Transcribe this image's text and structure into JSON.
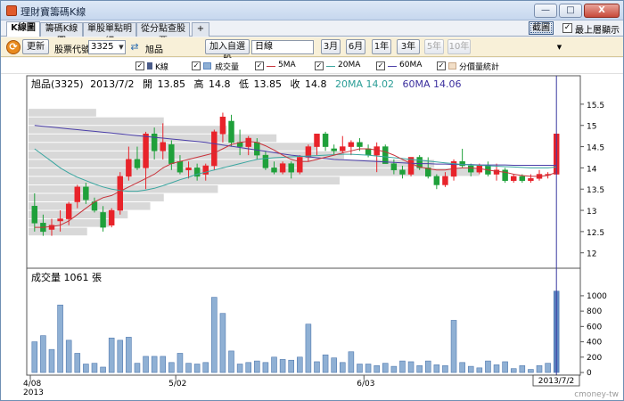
{
  "window": {
    "title": "理財寶籌碼K線",
    "minimize": "—",
    "maximize": "□",
    "close": "X"
  },
  "tabs": [
    "K線圖",
    "籌碼K線圖",
    "單股單點明細",
    "從分點查股票"
  ],
  "tab_add": "+",
  "screenshot_button": "截圖",
  "topmost": {
    "label": "最上層顯示",
    "checked": true
  },
  "toolbar": {
    "refresh": "更新",
    "code_label": "股票代號:",
    "code_value": "3325",
    "stock_name": "旭品",
    "add_fav": "加入自選股",
    "period": "日線",
    "ranges": [
      "3月",
      "6月",
      "1年",
      "3年",
      "5年",
      "10年"
    ],
    "ranges_disabled": [
      false,
      false,
      false,
      false,
      true,
      true
    ]
  },
  "legend": [
    {
      "label": "K線",
      "symbol": "candle"
    },
    {
      "label": "成交量",
      "symbol": "box"
    },
    {
      "label": "5MA",
      "symbol": "line-red"
    },
    {
      "label": "20MA",
      "symbol": "line-teal"
    },
    {
      "label": "60MA",
      "symbol": "line-navy"
    },
    {
      "label": "分價量統計",
      "symbol": "box-beige"
    }
  ],
  "colors": {
    "up": "#e8232a",
    "down": "#1fa03a",
    "ma5": "#c8323a",
    "ma20": "#3aa6a0",
    "ma60": "#4b3fa8",
    "volume": "#8fb0d4",
    "volume_highlight": "#5d88c2",
    "profile": "#d8d8d8",
    "cursor": "#3a3aa0"
  },
  "quote": {
    "name": "旭品(3325)",
    "date": "2013/7/2",
    "open_label": "開",
    "open": "13.85",
    "high_label": "高",
    "high": "14.8",
    "low_label": "低",
    "low": "13.85",
    "close_label": "收",
    "close": "14.8",
    "ma20": "20MA 14.02",
    "ma60": "60MA 14.06"
  },
  "volume_header": "成交量 1061 張",
  "watermark": "cmoney-tw",
  "chart_data": {
    "type": "candlestick",
    "price_axis": {
      "ticks": [
        "12",
        "12.5",
        "13",
        "13.5",
        "14",
        "14.5",
        "15",
        "15.5"
      ],
      "ylim": [
        11.7,
        15.75
      ]
    },
    "volume_axis": {
      "ticks": [
        "0",
        "200",
        "400",
        "600",
        "800",
        "1000"
      ],
      "ylim": [
        0,
        1150
      ]
    },
    "x_labels": [
      "4/08",
      "5/02",
      "6/03"
    ],
    "x_label_index": [
      0,
      17,
      39
    ],
    "year_label": "2013",
    "cursor_label": "2013/7/2",
    "candles": [
      [
        13.1,
        13.4,
        12.5,
        12.7,
        400
      ],
      [
        12.7,
        12.9,
        12.4,
        12.5,
        480
      ],
      [
        12.55,
        12.8,
        12.4,
        12.65,
        300
      ],
      [
        12.75,
        13.0,
        12.5,
        12.8,
        880
      ],
      [
        12.8,
        13.2,
        12.65,
        13.15,
        420
      ],
      [
        13.2,
        13.6,
        13.05,
        13.55,
        250
      ],
      [
        13.55,
        13.65,
        13.15,
        13.25,
        110
      ],
      [
        13.2,
        13.3,
        12.95,
        13.0,
        120
      ],
      [
        12.95,
        13.1,
        12.5,
        12.6,
        70
      ],
      [
        12.65,
        13.05,
        12.6,
        13.0,
        450
      ],
      [
        13.0,
        13.9,
        12.9,
        13.8,
        420
      ],
      [
        13.8,
        14.5,
        13.7,
        14.2,
        460
      ],
      [
        14.2,
        14.5,
        13.95,
        14.0,
        120
      ],
      [
        14.0,
        14.85,
        13.5,
        14.8,
        210
      ],
      [
        14.8,
        14.95,
        14.2,
        14.4,
        210
      ],
      [
        14.4,
        15.05,
        14.2,
        14.6,
        210
      ],
      [
        14.55,
        14.65,
        13.95,
        14.1,
        130
      ],
      [
        14.15,
        14.3,
        13.85,
        13.9,
        250
      ],
      [
        13.95,
        14.15,
        13.75,
        14.0,
        120
      ],
      [
        14.0,
        14.1,
        13.7,
        13.8,
        110
      ],
      [
        13.85,
        14.1,
        13.7,
        14.05,
        130
      ],
      [
        14.05,
        14.9,
        13.95,
        14.85,
        980
      ],
      [
        14.8,
        15.3,
        14.6,
        15.2,
        770
      ],
      [
        15.1,
        15.25,
        14.5,
        14.6,
        280
      ],
      [
        14.6,
        14.9,
        14.3,
        14.5,
        110
      ],
      [
        14.5,
        14.75,
        14.3,
        14.7,
        130
      ],
      [
        14.6,
        14.7,
        14.2,
        14.3,
        150
      ],
      [
        14.3,
        14.4,
        13.95,
        14.0,
        130
      ],
      [
        14.0,
        14.15,
        13.85,
        13.9,
        200
      ],
      [
        13.9,
        14.15,
        13.85,
        14.1,
        170
      ],
      [
        14.1,
        14.15,
        13.75,
        13.9,
        160
      ],
      [
        13.9,
        14.3,
        13.85,
        14.25,
        200
      ],
      [
        14.25,
        14.55,
        14.15,
        14.5,
        630
      ],
      [
        14.5,
        14.8,
        14.3,
        14.8,
        140
      ],
      [
        14.8,
        14.85,
        14.4,
        14.5,
        230
      ],
      [
        14.45,
        14.55,
        14.3,
        14.4,
        190
      ],
      [
        14.4,
        14.75,
        14.35,
        14.5,
        130
      ],
      [
        14.5,
        14.65,
        14.3,
        14.6,
        270
      ],
      [
        14.6,
        14.7,
        14.4,
        14.5,
        110
      ],
      [
        14.45,
        14.55,
        14.25,
        14.3,
        110
      ],
      [
        14.3,
        14.6,
        13.9,
        14.5,
        90
      ],
      [
        14.5,
        14.55,
        14.1,
        14.1,
        120
      ],
      [
        14.1,
        14.2,
        13.85,
        13.95,
        80
      ],
      [
        13.95,
        14.05,
        13.75,
        13.85,
        150
      ],
      [
        13.85,
        14.25,
        13.8,
        14.25,
        140
      ],
      [
        14.25,
        14.3,
        13.95,
        14.0,
        90
      ],
      [
        14.0,
        14.25,
        13.75,
        13.8,
        150
      ],
      [
        13.8,
        13.85,
        13.5,
        13.6,
        100
      ],
      [
        13.6,
        13.9,
        13.55,
        13.8,
        90
      ],
      [
        13.8,
        14.2,
        13.7,
        14.15,
        680
      ],
      [
        14.15,
        14.45,
        14.0,
        14.05,
        130
      ],
      [
        14.05,
        14.1,
        13.8,
        13.9,
        80
      ],
      [
        13.9,
        14.1,
        13.85,
        14.05,
        60
      ],
      [
        14.05,
        14.15,
        13.8,
        13.85,
        150
      ],
      [
        13.85,
        14.1,
        13.7,
        13.95,
        100
      ],
      [
        13.95,
        14.0,
        13.65,
        13.7,
        140
      ],
      [
        13.7,
        13.85,
        13.65,
        13.8,
        50
      ],
      [
        13.8,
        13.85,
        13.65,
        13.7,
        90
      ],
      [
        13.7,
        13.85,
        13.65,
        13.75,
        40
      ],
      [
        13.75,
        13.95,
        13.7,
        13.85,
        90
      ],
      [
        13.85,
        13.9,
        13.75,
        13.85,
        120
      ],
      [
        13.85,
        14.8,
        13.85,
        14.8,
        1061
      ]
    ],
    "ma5": [
      12.6,
      12.6,
      12.62,
      12.65,
      12.75,
      12.9,
      13.05,
      13.2,
      13.3,
      13.35,
      13.45,
      13.55,
      13.65,
      13.75,
      13.85,
      14.0,
      14.1,
      14.15,
      14.2,
      14.25,
      14.3,
      14.35,
      14.45,
      14.55,
      14.6,
      14.62,
      14.6,
      14.52,
      14.42,
      14.3,
      14.2,
      14.15,
      14.15,
      14.2,
      14.25,
      14.3,
      14.35,
      14.4,
      14.45,
      14.45,
      14.42,
      14.38,
      14.3,
      14.2,
      14.1,
      14.02,
      13.98,
      13.95,
      13.95,
      13.98,
      14.0,
      14.0,
      13.98,
      13.95,
      13.92,
      13.9,
      13.85,
      13.82,
      13.8,
      13.8,
      13.82,
      13.9
    ],
    "ma20": [
      14.45,
      14.3,
      14.15,
      14.0,
      13.88,
      13.78,
      13.7,
      13.62,
      13.55,
      13.5,
      13.47,
      13.45,
      13.45,
      13.48,
      13.52,
      13.58,
      13.65,
      13.72,
      13.78,
      13.85,
      13.9,
      13.95,
      14.0,
      14.05,
      14.1,
      14.15,
      14.2,
      14.22,
      14.24,
      14.25,
      14.26,
      14.27,
      14.28,
      14.29,
      14.3,
      14.31,
      14.32,
      14.32,
      14.31,
      14.3,
      14.28,
      14.26,
      14.24,
      14.22,
      14.2,
      14.18,
      14.16,
      14.14,
      14.12,
      14.1,
      14.08,
      14.07,
      14.06,
      14.05,
      14.04,
      14.03,
      14.02,
      14.01,
      14.0,
      14.0,
      14.0,
      14.02
    ],
    "ma60": [
      15.0,
      14.98,
      14.96,
      14.94,
      14.92,
      14.9,
      14.88,
      14.86,
      14.84,
      14.82,
      14.8,
      14.78,
      14.76,
      14.74,
      14.72,
      14.7,
      14.68,
      14.66,
      14.64,
      14.62,
      14.6,
      14.57,
      14.54,
      14.51,
      14.48,
      14.45,
      14.42,
      14.39,
      14.36,
      14.33,
      14.3,
      14.28,
      14.26,
      14.24,
      14.22,
      14.2,
      14.19,
      14.18,
      14.17,
      14.16,
      14.15,
      14.14,
      14.13,
      14.12,
      14.11,
      14.1,
      14.1,
      14.09,
      14.09,
      14.08,
      14.08,
      14.08,
      14.07,
      14.07,
      14.07,
      14.07,
      14.06,
      14.06,
      14.06,
      14.06,
      14.06,
      14.06
    ],
    "price_profile": [
      {
        "price": 12.5,
        "volume": 130
      },
      {
        "price": 12.7,
        "volume": 180
      },
      {
        "price": 12.9,
        "volume": 220
      },
      {
        "price": 13.1,
        "volume": 270
      },
      {
        "price": 13.3,
        "volume": 300
      },
      {
        "price": 13.5,
        "volume": 420
      },
      {
        "price": 13.7,
        "volume": 690
      },
      {
        "price": 13.9,
        "volume": 1000
      },
      {
        "price": 14.1,
        "volume": 900
      },
      {
        "price": 14.3,
        "volume": 700
      },
      {
        "price": 14.5,
        "volume": 640
      },
      {
        "price": 14.7,
        "volume": 550
      },
      {
        "price": 14.9,
        "volume": 440
      },
      {
        "price": 15.1,
        "volume": 300
      },
      {
        "price": 15.3,
        "volume": 150
      }
    ]
  }
}
